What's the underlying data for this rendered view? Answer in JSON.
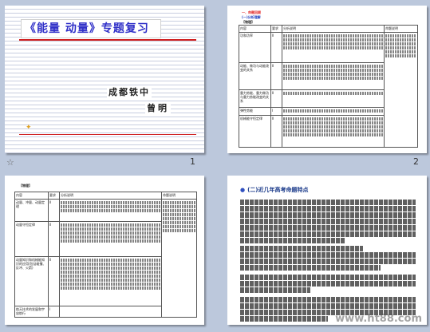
{
  "slides": [
    {
      "number": "1",
      "title": "《能量 动量》专题复习",
      "school": "成都铁中",
      "author": "曾明"
    },
    {
      "number": "2",
      "section_heading": "一、命题回顾",
      "sub_heading": "(一)分析理解",
      "table_heading": "【物理】",
      "columns": [
        "内容",
        "要求",
        "分析说明",
        "命题说明"
      ],
      "rows": [
        {
          "label": "功和功率",
          "level": "II"
        },
        {
          "label": "动能、做功与动能改变的关系",
          "level": "II"
        },
        {
          "label": "重力势能、重力做功与重力势能改变的关系",
          "level": "II"
        },
        {
          "label": "弹性势能",
          "level": "I"
        },
        {
          "label": "机械能守恒定律",
          "level": "II"
        }
      ]
    },
    {
      "number": "",
      "table_heading": "【物理】",
      "columns": [
        "内容",
        "要求",
        "分析说明",
        "命题说明"
      ],
      "rows": [
        {
          "label": "动量、冲量、动量定理",
          "level": "II"
        },
        {
          "label": "动量守恒定律",
          "level": "II"
        },
        {
          "label": "动量知识和机械能知识的应用(包括碰撞、反冲、火箭)",
          "level": "II"
        },
        {
          "label": "航天技术的发展和宇宙航行",
          "level": "I"
        }
      ]
    },
    {
      "number": "",
      "heading": "(二)近几年高考命题特点",
      "points": [
        "1.",
        "2.",
        "3."
      ]
    }
  ],
  "watermark": "www.ht88.com"
}
